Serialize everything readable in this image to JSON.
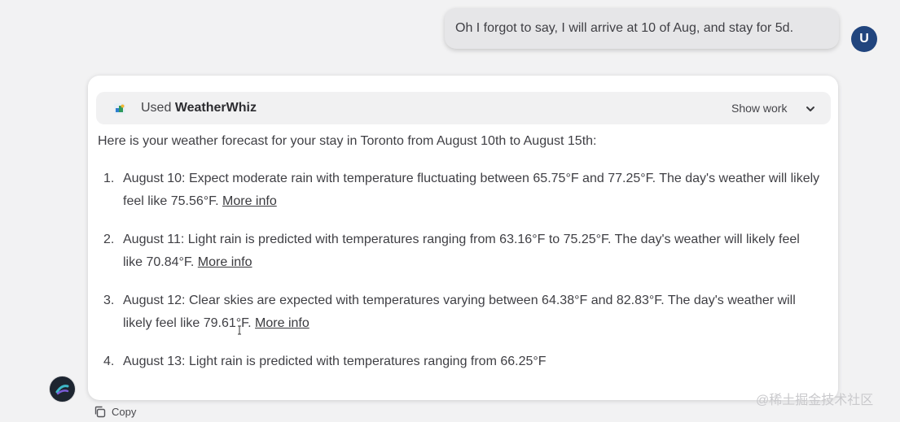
{
  "user_message": {
    "text": "Oh I forgot to say, I will arrive at 10 of Aug, and stay for 5d.",
    "avatar_letter": "U"
  },
  "assistant": {
    "tool": {
      "prefix": "Used",
      "name": "WeatherWhiz",
      "show_work_label": "Show work",
      "icon": "weatherwhiz-logo-icon"
    },
    "intro": "Here is your weather forecast for your stay in Toronto from August 10th to August 15th:",
    "forecast": [
      {
        "num": "1.",
        "text": "August 10: Expect moderate rain with temperature fluctuating between 65.75°F and 77.25°F. The day's weather will likely feel like 75.56°F.",
        "link": "More info"
      },
      {
        "num": "2.",
        "text": "August 11: Light rain is predicted with temperatures ranging from 63.16°F to 75.25°F. The day's weather will likely feel like 70.84°F.",
        "link": "More info"
      },
      {
        "num": "3.",
        "text": "August 12: Clear skies are expected with temperatures varying between 64.38°F and 82.83°F. The day's weather will likely feel like 79.61°F.",
        "link": "More info"
      },
      {
        "num": "4.",
        "text": "August 13: Light rain is predicted with temperatures ranging from 66.25°F",
        "link": ""
      }
    ],
    "copy_label": "Copy"
  },
  "watermark": "@稀土掘金技术社区",
  "colors": {
    "page_bg": "#f2f2f3",
    "user_bubble": "#e6e6e8",
    "user_avatar": "#21457e",
    "card_bg": "#ffffff",
    "tool_bar_bg": "#f1f1f2"
  }
}
